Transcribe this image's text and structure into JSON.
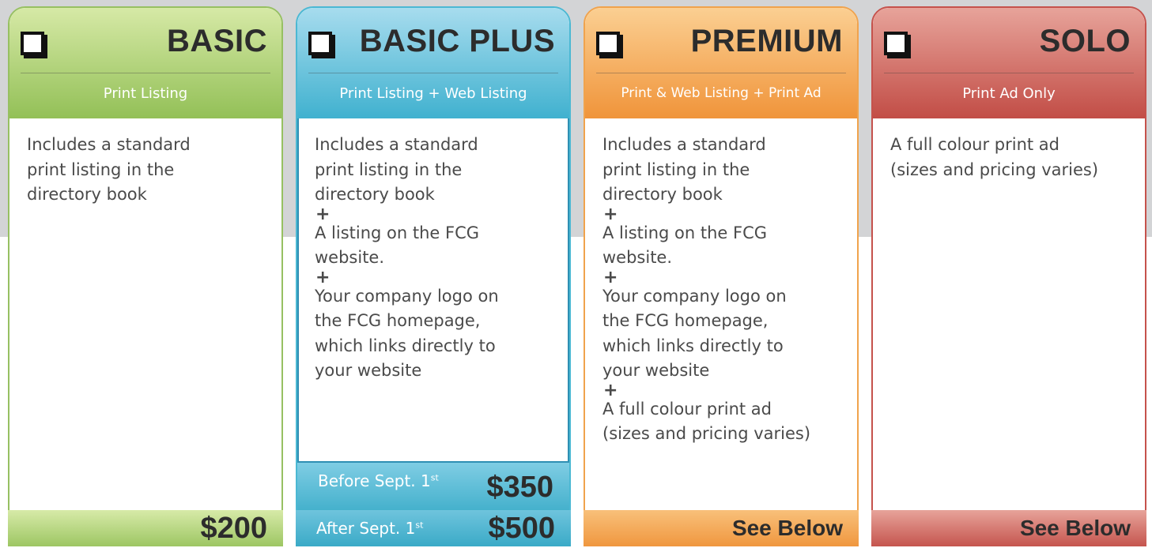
{
  "plans": {
    "basic": {
      "title": "BASIC",
      "subtitle": "Print Listing",
      "body": [
        "Includes a standard",
        "print listing in the",
        "directory book"
      ],
      "price": "$200",
      "color": "#93c057"
    },
    "basic_plus": {
      "title": "BASIC PLUS",
      "subtitle": "Print Listing + Web Listing",
      "body1": [
        "Includes a standard",
        "print listing in the",
        "directory book"
      ],
      "plus": "+",
      "body2": [
        "A listing on the FCG",
        "website."
      ],
      "body3": [
        "Your company logo on",
        "the FCG homepage,",
        "which links directly to",
        "your website"
      ],
      "before_label": "Before Sept. 1",
      "before_sup": "st",
      "before_price": "$350",
      "after_label": "After Sept. 1",
      "after_sup": "st",
      "after_price": "$500",
      "color": "#40b1cf"
    },
    "premium": {
      "title": "PREMIUM",
      "subtitle": "Print & Web Listing + Print Ad",
      "body1": [
        "Includes a standard",
        "print listing in the",
        "directory book"
      ],
      "plus": "+",
      "body2": [
        "A listing on the FCG",
        "website."
      ],
      "body3": [
        "Your company logo on",
        "the FCG homepage,",
        "which links directly to",
        "your website"
      ],
      "body4": [
        "A full colour print ad",
        "(sizes and pricing varies)"
      ],
      "price": "See Below",
      "color": "#f0943a"
    },
    "solo": {
      "title": "SOLO",
      "subtitle": "Print Ad Only",
      "body": [
        "A full colour print ad",
        "(sizes and pricing varies)"
      ],
      "price": "See Below",
      "color": "#c24d46"
    }
  }
}
